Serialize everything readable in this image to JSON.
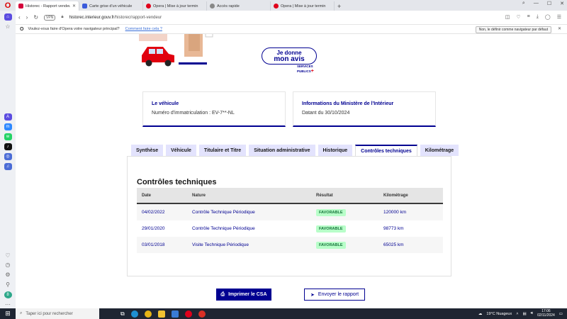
{
  "browser": {
    "tabs": [
      {
        "label": "Historec - Rapport vendeur",
        "active": true,
        "color": "#d4003b"
      },
      {
        "label": "Carte grise d'un véhicule",
        "active": false,
        "color": "#3b5bdb"
      },
      {
        "label": "Opera | Mise à jour termin",
        "active": false,
        "color": "#e0001b"
      },
      {
        "label": "Accès rapide",
        "active": false,
        "color": "#888888"
      },
      {
        "label": "Opera | Mise à jour termin",
        "active": false,
        "color": "#e0001b"
      }
    ],
    "vpn_label": "VPN",
    "url_domain": "historec.interieur.gouv.fr",
    "url_path": "/historec/rapport-vendeur",
    "infobar": {
      "message": "Voulez-vous faire d'Opera votre navigateur principal?",
      "link": "Comment faire cela ?",
      "button": "Non, le définir comme navigateur par défaut"
    }
  },
  "page": {
    "feedback": {
      "line1": "Je donne",
      "line2": "mon avis",
      "logo_line1": "SERVICES",
      "logo_line2": "PUBLICS"
    },
    "cards": [
      {
        "title": "Le véhicule",
        "value": "Numéro d'immatriculation : EV-7**-NL"
      },
      {
        "title": "Informations du Ministère de l'Intérieur",
        "value": "Datant du 30/10/2024"
      }
    ],
    "tabs": [
      {
        "label": "Synthèse",
        "active": false
      },
      {
        "label": "Véhicule",
        "active": false
      },
      {
        "label": "Titulaire et Titre",
        "active": false
      },
      {
        "label": "Situation administrative",
        "active": false
      },
      {
        "label": "Historique",
        "active": false
      },
      {
        "label": "Contrôles techniques",
        "active": true
      },
      {
        "label": "Kilométrage",
        "active": false
      }
    ],
    "section_title": "Contrôles techniques",
    "table": {
      "headers": [
        "Date",
        "Nature",
        "Résultat",
        "Kilométrage"
      ],
      "rows": [
        {
          "date": "04/02/2022",
          "nature": "Contrôle Technique Périodique",
          "result": "FAVORABLE",
          "km": "120000 km"
        },
        {
          "date": "29/01/2020",
          "nature": "Contrôle Technique Périodique",
          "result": "FAVORABLE",
          "km": "98773 km"
        },
        {
          "date": "03/01/2018",
          "nature": "Visite Technique Périodique",
          "result": "FAVORABLE",
          "km": "65025 km"
        }
      ]
    },
    "buttons": {
      "print": "Imprimer le CSA",
      "send": "Envoyer le rapport"
    }
  },
  "taskbar": {
    "search_placeholder": "Taper ici pour rechercher",
    "weather": "19°C  Nuageux",
    "time": "17:06",
    "date": "02/11/2024"
  },
  "colors": {
    "primary": "#000091",
    "success_bg": "#b8fec9",
    "success_text": "#18753c"
  }
}
